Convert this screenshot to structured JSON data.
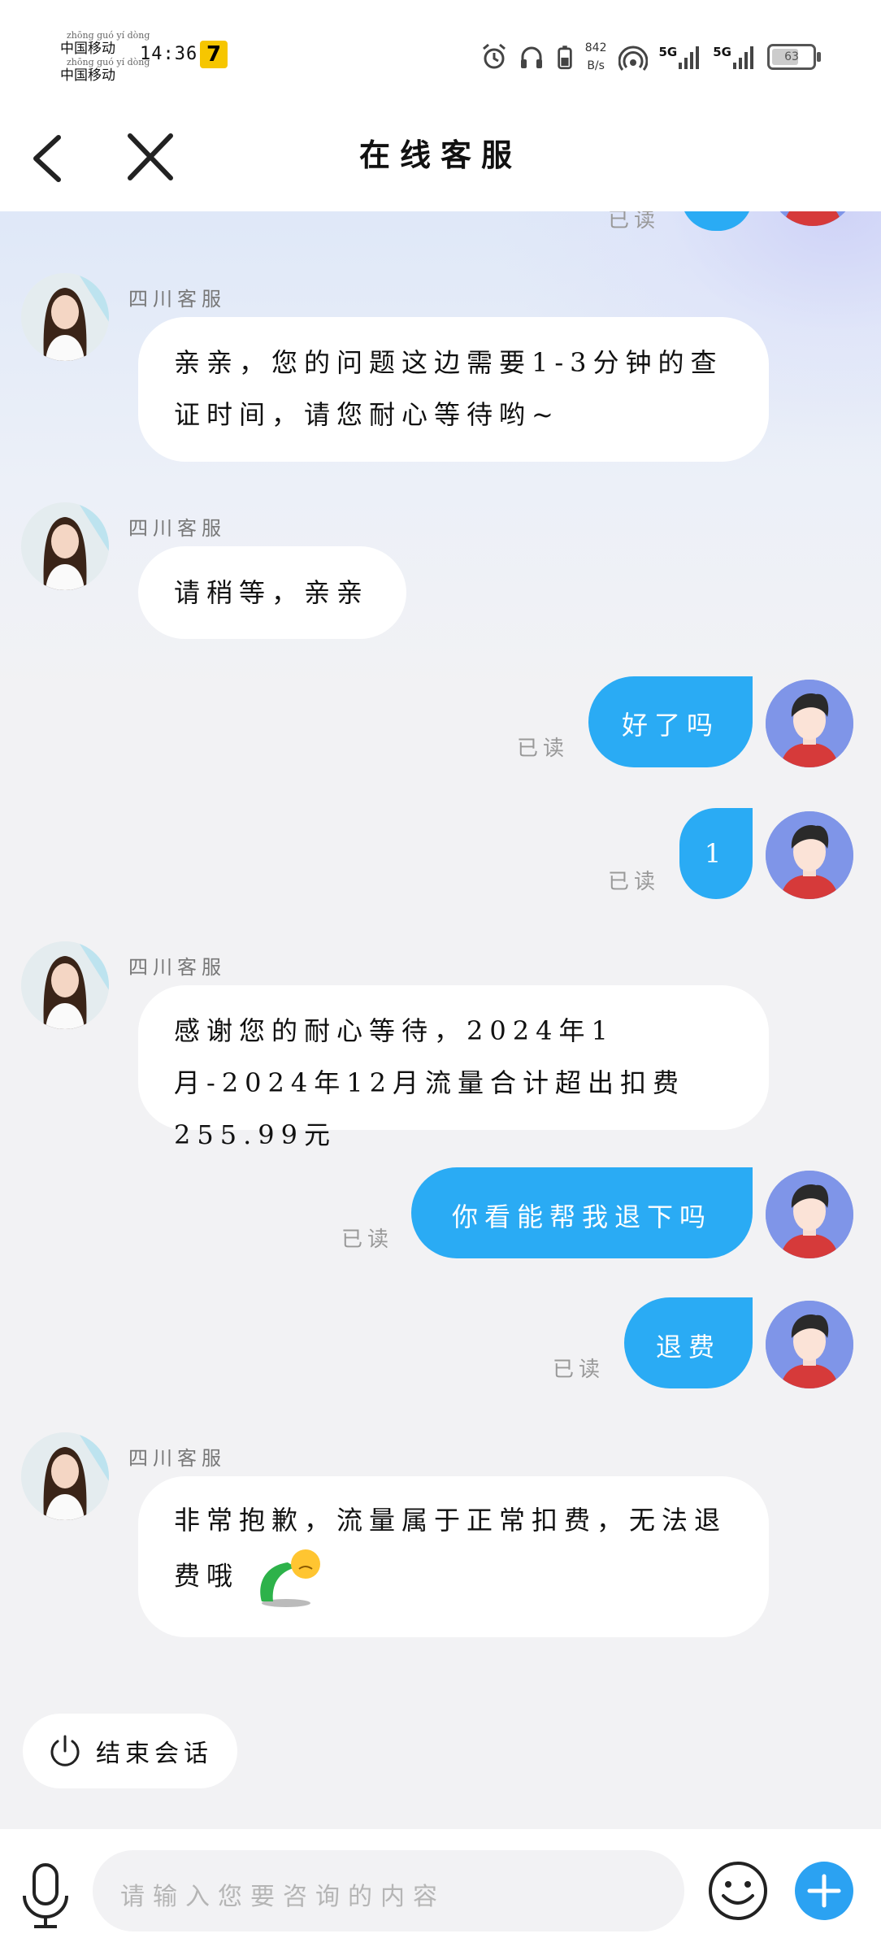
{
  "status_bar": {
    "carrier_1": "中国移动",
    "carrier_1_pinyin": "zhōng guó yí dòng",
    "carrier_2": "中国移动",
    "carrier_2_pinyin": "zhōng guó yí dòng",
    "time": "14:36",
    "app_badge": "7",
    "network_speed_value": "842",
    "network_speed_unit": "B/s",
    "signal_1": "5G",
    "signal_2": "5G",
    "battery": "63"
  },
  "header": {
    "title": "在线客服"
  },
  "messages": [
    {
      "side": "agent",
      "name": "四川客服",
      "text": "亲亲，您的问题这边需要1-3分钟的查证时间，请您耐心等待哟~"
    },
    {
      "side": "agent",
      "name": "四川客服",
      "text": "请稍等，亲亲"
    },
    {
      "side": "user",
      "text": "好了吗",
      "status": "已读"
    },
    {
      "side": "user",
      "text": "1",
      "status": "已读"
    },
    {
      "side": "agent",
      "name": "四川客服",
      "text": "感谢您的耐心等待，2024年1月-2024年12月流量合计超出扣费255.99元"
    },
    {
      "side": "user",
      "text": "你看能帮我退下吗",
      "status": "已读"
    },
    {
      "side": "user",
      "text": "退费",
      "status": "已读"
    },
    {
      "side": "agent",
      "name": "四川客服",
      "text": "非常抱歉，流量属于正常扣费，无法退费哦"
    }
  ],
  "partial_top": {
    "status": "已读"
  },
  "end_session": {
    "label": "结束会话"
  },
  "input": {
    "placeholder": "请输入您要咨询的内容"
  },
  "colors": {
    "accent": "#2aabf4",
    "user_bubble": "#2aabf4",
    "agent_bubble": "#ffffff",
    "background": "#f2f2f4"
  }
}
